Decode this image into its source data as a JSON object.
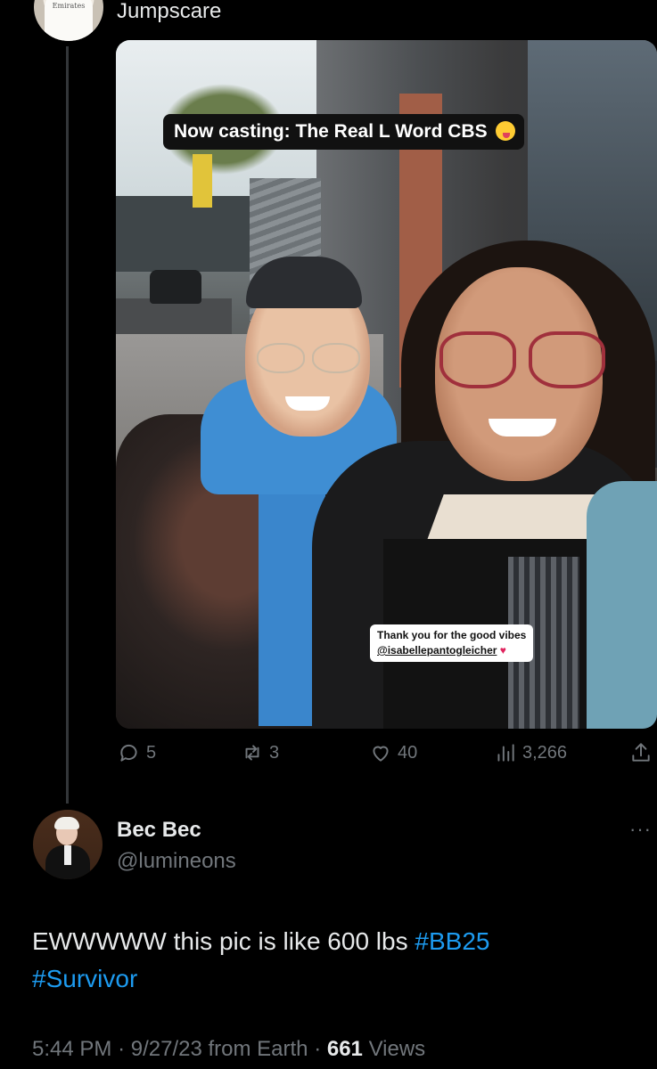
{
  "parent_post": {
    "display_name": "Jumpscare",
    "avatar_shirt_text": "Emirates",
    "photo": {
      "story_caption": "Now casting: The Real L Word CBS",
      "thanks_line1": "Thank you for the good vibes",
      "thanks_handle": "@isabellepantogleicher"
    },
    "actions": {
      "replies": "5",
      "reposts": "3",
      "likes": "40",
      "views": "3,266"
    }
  },
  "reply_post": {
    "display_name": "Bec Bec",
    "handle": "@lumineons",
    "more_label": "···",
    "text_main": "EWWWWW this pic is like 600 lbs ",
    "hashtag1": "#BB25",
    "hashtag2": "#Survivor",
    "meta": {
      "time": "5:44 PM",
      "date": "9/27/23",
      "source": "from Earth",
      "views_count": "661",
      "views_label": "Views"
    }
  },
  "colors": {
    "background": "#000000",
    "text": "#e7e9ea",
    "muted": "#71767b",
    "link": "#1d9bf0"
  }
}
